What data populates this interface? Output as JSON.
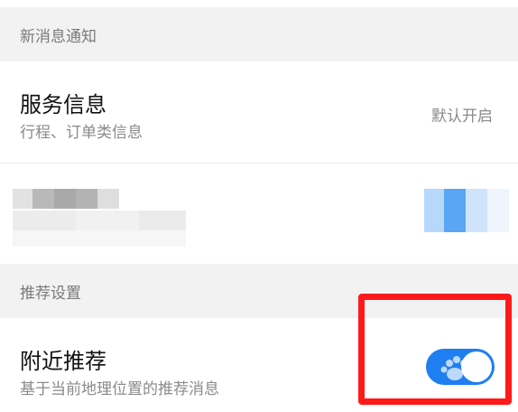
{
  "sections": {
    "new_message": "新消息通知",
    "recommend": "推荐设置"
  },
  "service_info": {
    "title": "服务信息",
    "subtitle": "行程、订单类信息",
    "value": "默认开启"
  },
  "nearby": {
    "title": "附近推荐",
    "subtitle": "基于当前地理位置的推荐消息",
    "enabled": true
  },
  "colors": {
    "accent": "#1f7ef0",
    "highlight": "#ff1a1a"
  },
  "icons": {
    "toggle_knob": "toggle-knob-icon",
    "watermark": "baidu-paw-watermark-icon"
  }
}
